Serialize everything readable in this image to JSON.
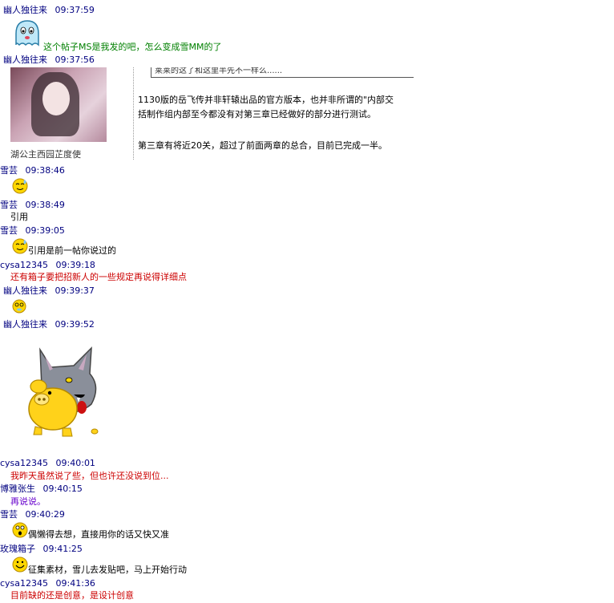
{
  "messages": [
    {
      "sender": "幽人独往来",
      "time": "09:37:59",
      "text": "这个帖子MS是我发的吧，怎么变成雪MM的了"
    },
    {
      "sender": "幽人独往来",
      "time": "09:37:56",
      "embed": {
        "box_text": "莱莱的这了和这里半先不一样么......",
        "line1": "1130版的岳飞传并非轩辕出品的官方版本，也并非所谓的\"内部交",
        "line2": "括制作组内部至今都没有对第三章已经做好的部分进行测试。",
        "line3": "第三章有将近20关，超过了前面两章的总合，目前已完成一半。",
        "caption": "湖公主西园芷度使"
      }
    },
    {
      "sender": "雪芸",
      "time": "09:38:46"
    },
    {
      "sender": "雪芸",
      "time": "09:38:49",
      "text": "引用"
    },
    {
      "sender": "雪芸",
      "time": "09:39:05",
      "text": "引用是前一帖你说过的"
    },
    {
      "sender": "cysa12345",
      "time": "09:39:18",
      "text": "还有箱子要把招新人的一些规定再说得详细点"
    },
    {
      "sender": "幽人独往来",
      "time": "09:39:37"
    },
    {
      "sender": "幽人独往来",
      "time": "09:39:52"
    },
    {
      "sender": "cysa12345",
      "time": "09:40:01",
      "text": "我昨天虽然说了些，但也许还没说到位..."
    },
    {
      "sender": "博雅张生",
      "time": "09:40:15",
      "text": "再说说。"
    },
    {
      "sender": "雪芸",
      "time": "09:40:29",
      "text": "偶懒得去想，直接用你的话又快又准"
    },
    {
      "sender": "玫瑰箱子",
      "time": "09:41:25",
      "text": "征集素材，雪儿去发贴吧，马上开始行动"
    },
    {
      "sender": "cysa12345",
      "time": "09:41:36",
      "text": "目前缺的还是创意，是设计创意"
    }
  ],
  "colors": {
    "sender": "#000080",
    "red": "#cc0000",
    "green": "#008000",
    "purple": "#6600cc"
  },
  "icons": [
    "ghost-emoticon",
    "sweat-emoticon",
    "dizzy-emoticon",
    "wolf-pig-sticker",
    "surprised-emoticon",
    "smile-emoticon"
  ]
}
